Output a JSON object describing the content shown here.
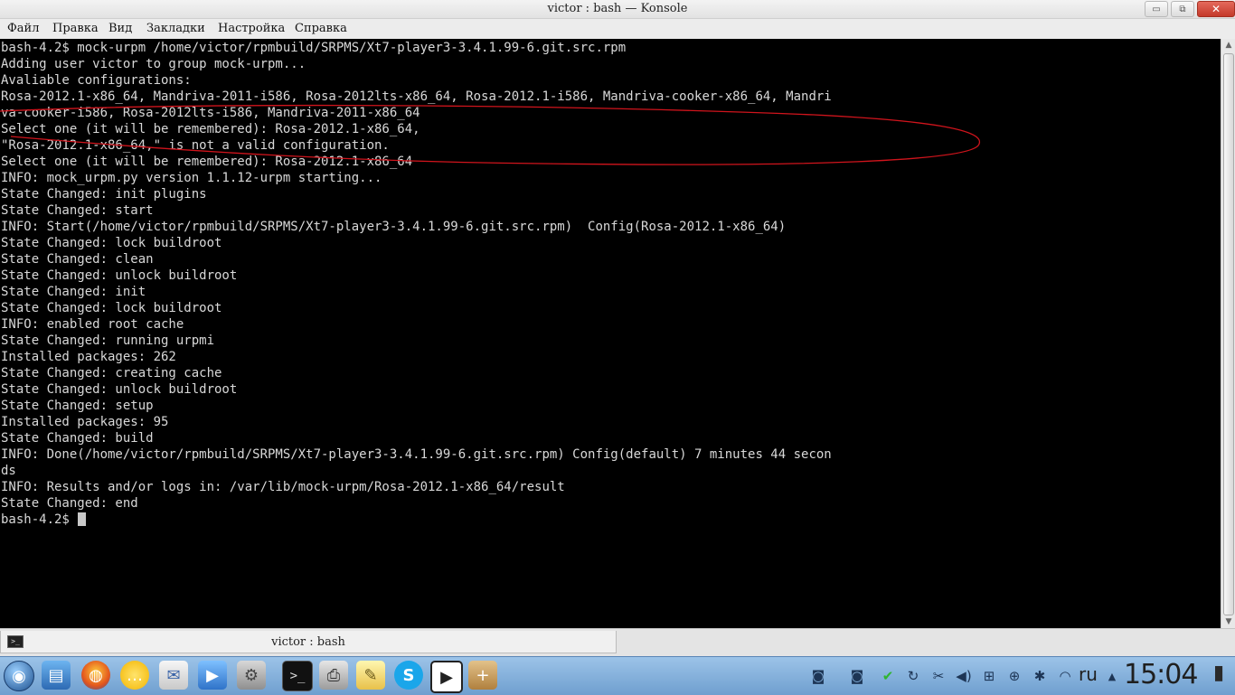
{
  "window": {
    "title": "victor : bash — Konsole",
    "controls": {
      "minimize": "▭",
      "maximize": "⧉",
      "close": "✕"
    }
  },
  "menu": [
    "Файл",
    "Правка",
    "Вид",
    "Закладки",
    "Настройка",
    "Справка"
  ],
  "terminal": {
    "lines": [
      "bash-4.2$ mock-urpm /home/victor/rpmbuild/SRPMS/Xt7-player3-3.4.1.99-6.git.src.rpm",
      "Adding user victor to group mock-urpm...",
      "Avaliable configurations:",
      "Rosa-2012.1-x86_64, Mandriva-2011-i586, Rosa-2012lts-x86_64, Rosa-2012.1-i586, Mandriva-cooker-x86_64, Mandri",
      "va-cooker-i586, Rosa-2012lts-i586, Mandriva-2011-x86_64",
      "Select one (it will be remembered): Rosa-2012.1-x86_64,",
      "\"Rosa-2012.1-x86_64,\" is not a valid configuration.",
      "Select one (it will be remembered): Rosa-2012.1-x86_64",
      "INFO: mock_urpm.py version 1.1.12-urpm starting...",
      "State Changed: init plugins",
      "State Changed: start",
      "INFO: Start(/home/victor/rpmbuild/SRPMS/Xt7-player3-3.4.1.99-6.git.src.rpm)  Config(Rosa-2012.1-x86_64)",
      "State Changed: lock buildroot",
      "State Changed: clean",
      "State Changed: unlock buildroot",
      "State Changed: init",
      "State Changed: lock buildroot",
      "INFO: enabled root cache",
      "State Changed: running urpmi",
      "Installed packages: 262",
      "State Changed: creating cache",
      "State Changed: unlock buildroot",
      "State Changed: setup",
      "Installed packages: 95",
      "State Changed: build",
      "INFO: Done(/home/victor/rpmbuild/SRPMS/Xt7-player3-3.4.1.99-6.git.src.rpm) Config(default) 7 minutes 44 secon",
      "ds",
      "INFO: Results and/or logs in: /var/lib/mock-urpm/Rosa-2012.1-x86_64/result",
      "State Changed: end"
    ],
    "prompt": "bash-4.2$ ",
    "annotation_color": "#d0141c"
  },
  "tab": {
    "label": "victor : bash",
    "icon_glyph": ">_"
  },
  "panel": {
    "launcher_glyph": "◉",
    "glyphs": {
      "files": "▤",
      "firefox": "◍",
      "chat": "…",
      "mail": "✉",
      "video": "▶",
      "settings": "⚙",
      "terminal": ">_",
      "printer": "⎙",
      "notes": "✎",
      "skype": "S",
      "player": "▶",
      "package": "+"
    },
    "tray_glyphs": {
      "camera1": "◙",
      "camera2": "◙",
      "check": "✔",
      "sync": "↻",
      "scissors": "✂",
      "volume": "◀)",
      "network": "⊞",
      "globe": "⊕",
      "bluetooth": "✱",
      "wifi": "◠",
      "expand": "▲",
      "battery": "▮"
    },
    "language": "ru",
    "clock": "15:04",
    "colors": {
      "check": "#2fb52f",
      "battery": "#2a2a2a"
    }
  },
  "scrollbar": {
    "up": "▲",
    "down": "▼"
  }
}
